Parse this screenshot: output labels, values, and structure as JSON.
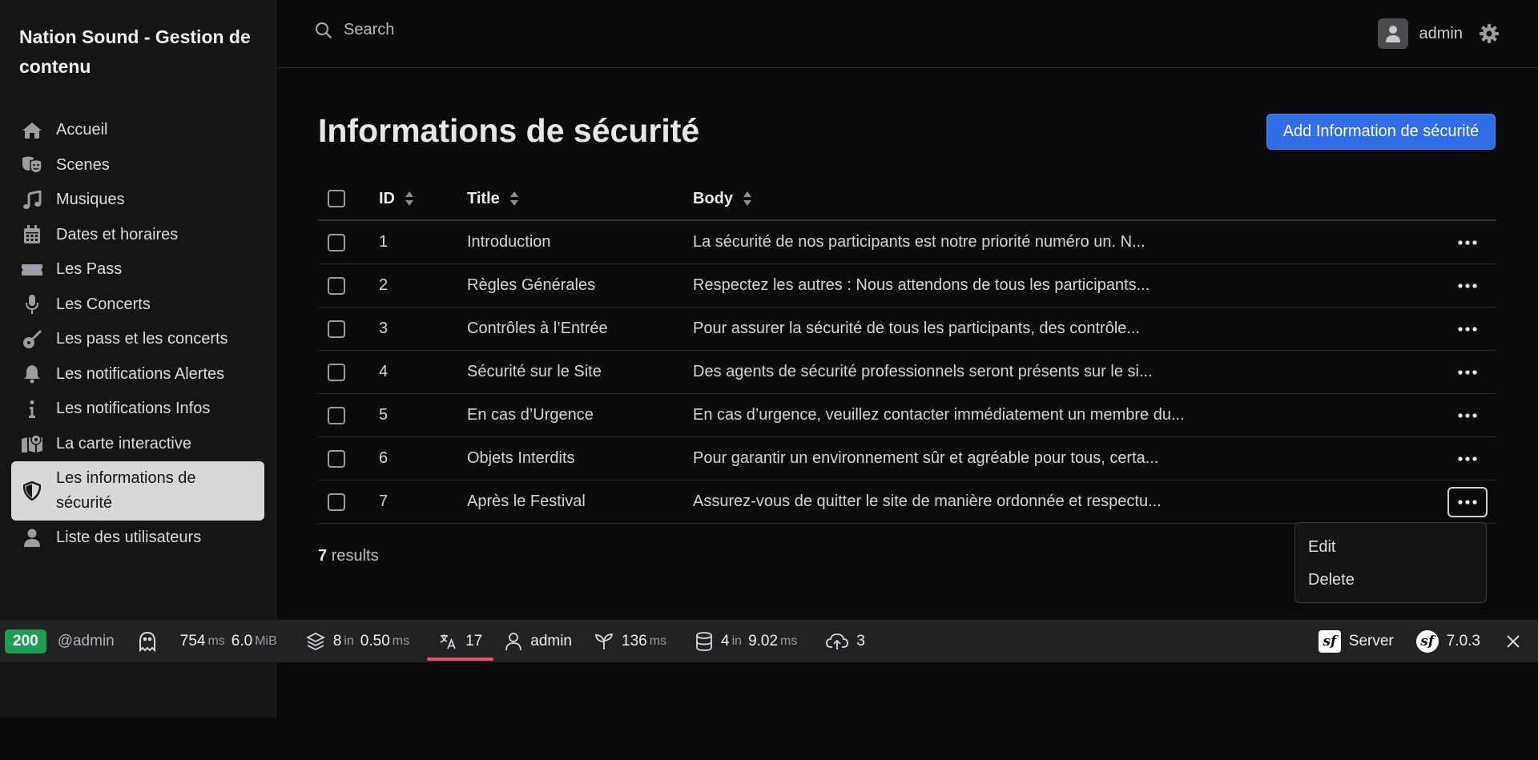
{
  "app": {
    "title": "Nation Sound - Gestion de contenu"
  },
  "sidebar": {
    "items": [
      {
        "label": "Accueil",
        "icon": "home-icon"
      },
      {
        "label": "Scenes",
        "icon": "theater-masks-icon"
      },
      {
        "label": "Musiques",
        "icon": "music-note-icon"
      },
      {
        "label": "Dates et horaires",
        "icon": "calendar-icon"
      },
      {
        "label": "Les Pass",
        "icon": "ticket-icon"
      },
      {
        "label": "Les Concerts",
        "icon": "microphone-icon"
      },
      {
        "label": "Les pass et les concerts",
        "icon": "guitar-icon"
      },
      {
        "label": "Les notifications Alertes",
        "icon": "bell-icon"
      },
      {
        "label": "Les notifications Infos",
        "icon": "info-icon"
      },
      {
        "label": "La carte interactive",
        "icon": "map-location-icon"
      },
      {
        "label": "Les informations de sécurité",
        "icon": "shield-icon",
        "active": true
      },
      {
        "label": "Liste des utilisateurs",
        "icon": "user-icon"
      }
    ]
  },
  "header": {
    "search_placeholder": "Search",
    "username": "admin"
  },
  "main": {
    "title": "Informations de sécurité",
    "add_button": "Add Information de sécurité",
    "columns": {
      "id": "ID",
      "title": "Title",
      "body": "Body"
    },
    "rows": [
      {
        "id": "1",
        "title": "Introduction",
        "body": "La sécurité de nos participants est notre priorité numéro un. N..."
      },
      {
        "id": "2",
        "title": "Règles Générales",
        "body": "Respectez les autres : Nous attendons de tous les participants..."
      },
      {
        "id": "3",
        "title": "Contrôles à l’Entrée",
        "body": "Pour assurer la sécurité de tous les participants, des contrôle..."
      },
      {
        "id": "4",
        "title": "Sécurité sur le Site",
        "body": "Des agents de sécurité professionnels seront présents sur le si..."
      },
      {
        "id": "5",
        "title": "En cas d’Urgence",
        "body": "En cas d’urgence, veuillez contacter immédiatement un membre du..."
      },
      {
        "id": "6",
        "title": "Objets Interdits",
        "body": "Pour garantir un environnement sûr et agréable pour tous, certa..."
      },
      {
        "id": "7",
        "title": "Après le Festival",
        "body": "Assurez-vous de quitter le site de manière ordonnée et respectu..."
      }
    ],
    "results_count": "7",
    "results_label": "results",
    "action_menu": {
      "edit": "Edit",
      "delete": "Delete"
    }
  },
  "debug_toolbar": {
    "status": "200",
    "user_tag": "@admin",
    "time": "754",
    "time_unit": "ms",
    "memory": "6.0",
    "memory_unit": "MiB",
    "layers_count": "8",
    "layers_in": "in",
    "layers_time": "0.50",
    "layers_unit": "ms",
    "translations": "17",
    "security_user": "admin",
    "twig_time": "136",
    "twig_unit": "ms",
    "db_count": "4",
    "db_in": "in",
    "db_time": "9.02",
    "db_unit": "ms",
    "uploads": "3",
    "server_label": "Server",
    "version": "7.0.3",
    "status_color": "#1f9d55"
  },
  "colors": {
    "accent": "#2f6ee6",
    "active_nav_bg": "#d8d8da",
    "toolbar_highlight": "#e9566a"
  }
}
